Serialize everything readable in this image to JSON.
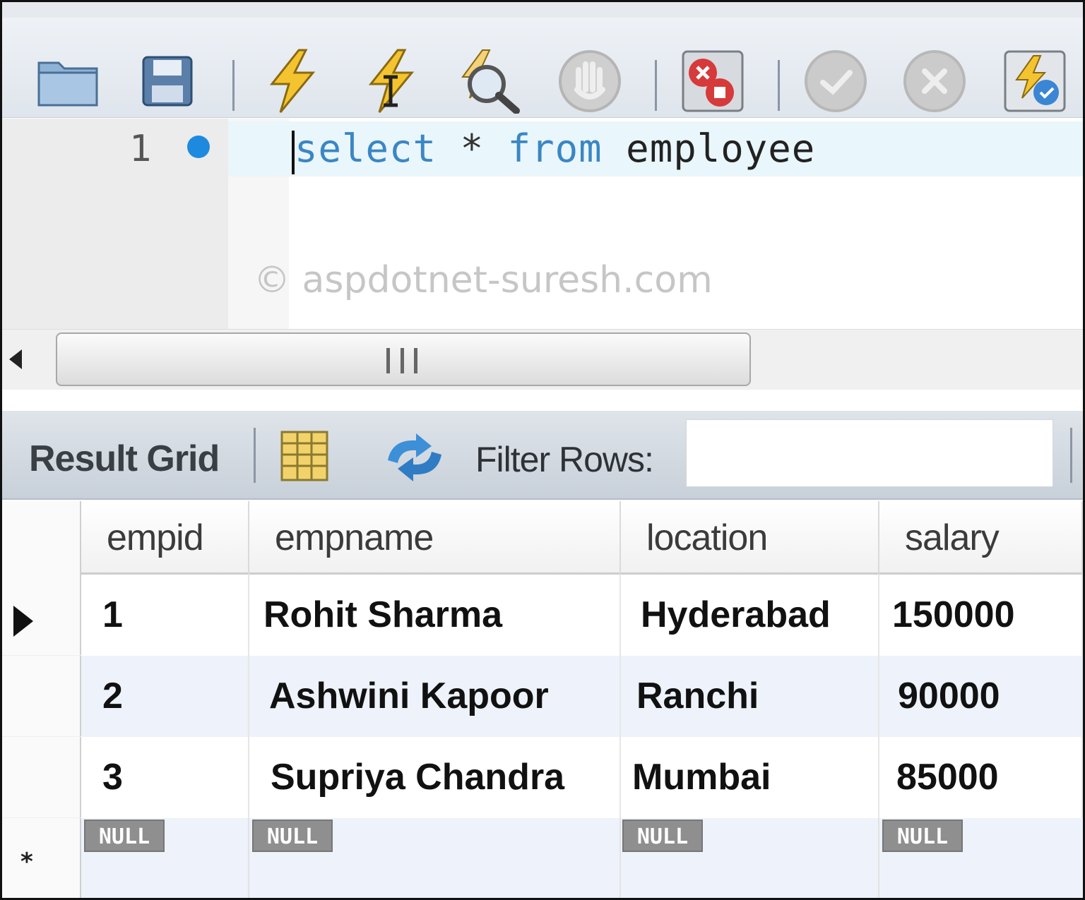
{
  "toolbar": {
    "buttons": [
      {
        "name": "open-folder",
        "icon": "folder-icon"
      },
      {
        "name": "save",
        "icon": "floppy-disk-icon"
      },
      {
        "name": "execute",
        "icon": "lightning-icon"
      },
      {
        "name": "execute-current",
        "icon": "lightning-cursor-icon"
      },
      {
        "name": "explain",
        "icon": "magnifier-icon"
      },
      {
        "name": "stop",
        "icon": "hand-stop-icon"
      },
      {
        "name": "toggle-continue-on-error",
        "icon": "error-stop-icon"
      },
      {
        "name": "commit",
        "icon": "check-circle-icon"
      },
      {
        "name": "rollback",
        "icon": "x-circle-icon"
      },
      {
        "name": "autocommit",
        "icon": "autocommit-icon"
      }
    ]
  },
  "editor": {
    "line_number": "1",
    "sql": {
      "kw1": "select",
      "op": " * ",
      "kw2": "from",
      "ident": " employee"
    },
    "watermark": "© aspdotnet-suresh.com"
  },
  "result_toolbar": {
    "title": "Result Grid",
    "filter_label": "Filter Rows:",
    "filter_value": ""
  },
  "grid": {
    "columns": [
      "empid",
      "empname",
      "location",
      "salary"
    ],
    "rows": [
      [
        "1",
        "Rohit Sharma",
        "Hyderabad",
        "150000"
      ],
      [
        "2",
        "Ashwini Kapoor",
        "Ranchi",
        "90000"
      ],
      [
        "3",
        "Supriya Chandra",
        "Mumbai",
        "85000"
      ]
    ],
    "null_label": "NULL"
  },
  "colors": {
    "keyword": "#3b86c4",
    "marker": "#1d8ae0",
    "alt_row": "#edf2fb"
  }
}
